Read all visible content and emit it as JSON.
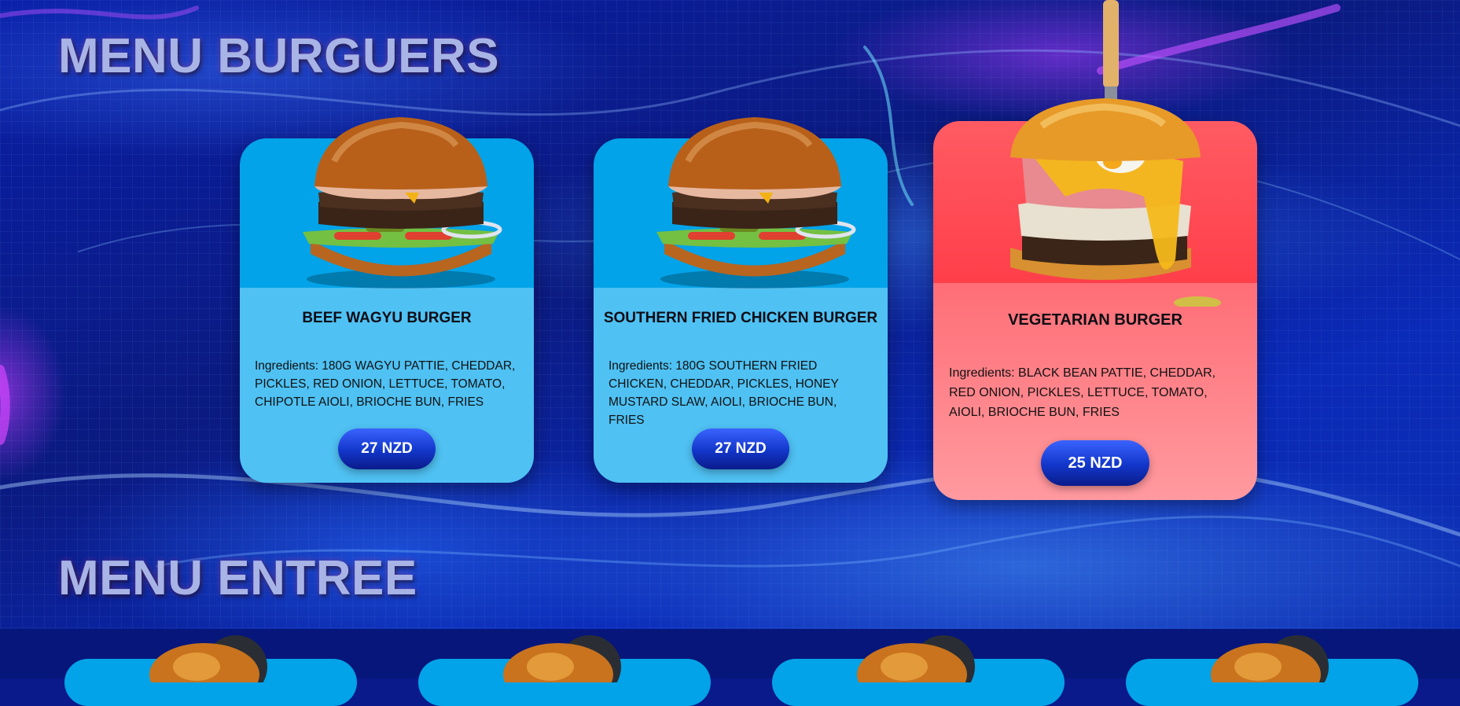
{
  "sections": {
    "burgers_title": "MENU BURGUERS",
    "entree_title": "MENU ENTREE"
  },
  "burgers": [
    {
      "name": "BEEF WAGYU BURGER",
      "ingredients": "Ingredients: 180G WAGYU PATTIE, CHEDDAR, PICKLES, RED ONION, LETTUCE, TOMATO, CHIPOTLE AIOLI, BRIOCHE BUN, FRIES",
      "price": "27 NZD",
      "image_icon": "beef-burger-image"
    },
    {
      "name": "SOUTHERN FRIED CHICKEN BURGER",
      "ingredients": "Ingredients: 180G SOUTHERN FRIED CHICKEN, CHEDDAR, PICKLES, HONEY MUSTARD SLAW, AIOLI, BRIOCHE BUN, FRIES",
      "price": "27 NZD",
      "image_icon": "chicken-burger-image"
    },
    {
      "name": "VEGETARIAN BURGER",
      "ingredients": "Ingredients: BLACK BEAN PATTIE, CHEDDAR, RED ONION, PICKLES, LETTUCE, TOMATO, AIOLI, BRIOCHE BUN, FRIES",
      "price": "25 NZD",
      "image_icon": "vegetarian-burger-image"
    }
  ],
  "colors": {
    "card_blue_top": "#02a3e8",
    "card_blue_bottom": "#4fc1f3",
    "card_red_top": "#ff4650",
    "card_red_bottom": "#ff9aa0",
    "price_button": "#1236c9",
    "title": "#a9b4e6"
  }
}
